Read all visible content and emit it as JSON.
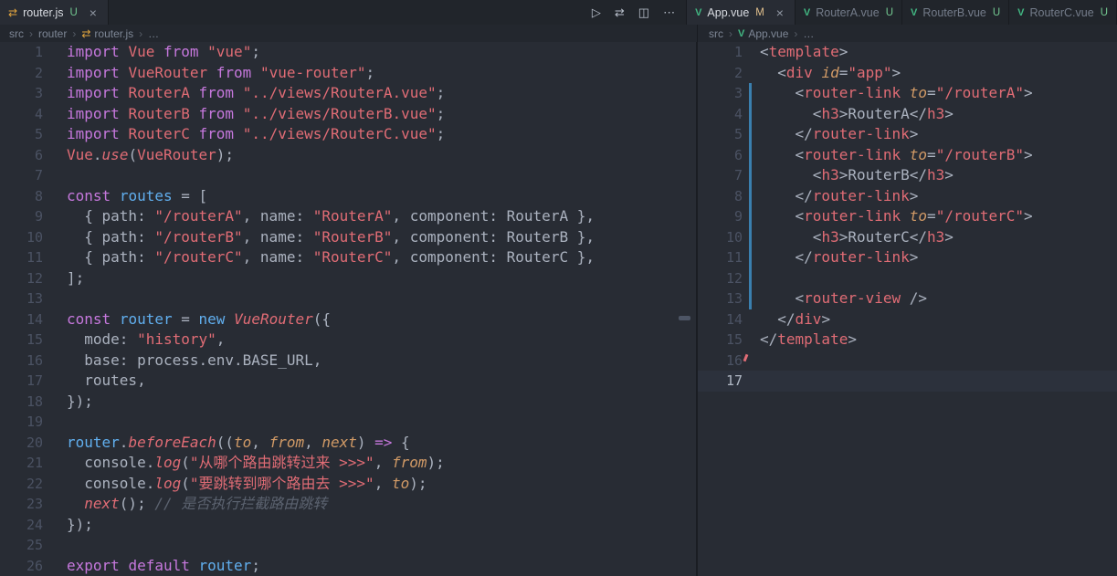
{
  "icons": {
    "vue": "V",
    "routing": "⇄",
    "close": "×",
    "crumb_sep": "›"
  },
  "colors": {
    "keyword": "#c678dd",
    "string": "#e06c75",
    "attribute": "#d19a66",
    "identifier_blue": "#61afef",
    "comment": "#5c6370",
    "git_untracked": "#73c991",
    "git_modified": "#e2c08d",
    "vue_green": "#42b883",
    "gutter_modified_bar": "#3a7fae"
  },
  "tabs_left": [
    {
      "label": "router.js",
      "status": "U",
      "icon": "routing",
      "active": true,
      "closable": true
    }
  ],
  "tabs_right": [
    {
      "label": "App.vue",
      "status": "M",
      "icon": "vue",
      "active": true,
      "closable": true
    },
    {
      "label": "RouterA.vue",
      "status": "U",
      "icon": "vue",
      "active": false
    },
    {
      "label": "RouterB.vue",
      "status": "U",
      "icon": "vue",
      "active": false
    },
    {
      "label": "RouterC.vue",
      "status": "U",
      "icon": "vue",
      "active": false
    }
  ],
  "actions": [
    {
      "name": "run",
      "glyph": "▷"
    },
    {
      "name": "open-changes",
      "glyph": "⇄"
    },
    {
      "name": "split-editor",
      "glyph": "◫"
    },
    {
      "name": "more-actions",
      "glyph": "⋯"
    }
  ],
  "breadcrumbs_left": [
    {
      "label": "src"
    },
    {
      "label": "router"
    },
    {
      "label": "router.js",
      "icon": "routing"
    },
    {
      "label": "…"
    }
  ],
  "breadcrumbs_right": [
    {
      "label": "src"
    },
    {
      "label": "App.vue",
      "icon": "vue"
    },
    {
      "label": "…"
    }
  ],
  "editor_left": {
    "lines": [
      {
        "t": [
          [
            "k",
            "import"
          ],
          [
            "d",
            " "
          ],
          [
            "e",
            "Vue"
          ],
          [
            "d",
            " "
          ],
          [
            "k",
            "from"
          ],
          [
            "d",
            " "
          ],
          [
            "s",
            "\"vue\""
          ],
          [
            "d",
            ";"
          ]
        ]
      },
      {
        "t": [
          [
            "k",
            "import"
          ],
          [
            "d",
            " "
          ],
          [
            "e",
            "VueRouter"
          ],
          [
            "d",
            " "
          ],
          [
            "k",
            "from"
          ],
          [
            "d",
            " "
          ],
          [
            "s",
            "\"vue-router\""
          ],
          [
            "d",
            ";"
          ]
        ]
      },
      {
        "t": [
          [
            "k",
            "import"
          ],
          [
            "d",
            " "
          ],
          [
            "e",
            "RouterA"
          ],
          [
            "d",
            " "
          ],
          [
            "k",
            "from"
          ],
          [
            "d",
            " "
          ],
          [
            "s",
            "\"../views/RouterA.vue\""
          ],
          [
            "d",
            ";"
          ]
        ]
      },
      {
        "t": [
          [
            "k",
            "import"
          ],
          [
            "d",
            " "
          ],
          [
            "e",
            "RouterB"
          ],
          [
            "d",
            " "
          ],
          [
            "k",
            "from"
          ],
          [
            "d",
            " "
          ],
          [
            "s",
            "\"../views/RouterB.vue\""
          ],
          [
            "d",
            ";"
          ]
        ]
      },
      {
        "t": [
          [
            "k",
            "import"
          ],
          [
            "d",
            " "
          ],
          [
            "e",
            "RouterC"
          ],
          [
            "d",
            " "
          ],
          [
            "k",
            "from"
          ],
          [
            "d",
            " "
          ],
          [
            "s",
            "\"../views/RouterC.vue\""
          ],
          [
            "d",
            ";"
          ]
        ]
      },
      {
        "t": [
          [
            "e",
            "Vue"
          ],
          [
            "d",
            "."
          ],
          [
            "f",
            "use"
          ],
          [
            "d",
            "("
          ],
          [
            "e",
            "VueRouter"
          ],
          [
            "d",
            ");"
          ]
        ]
      },
      {
        "t": []
      },
      {
        "t": [
          [
            "k",
            "const"
          ],
          [
            "d",
            " "
          ],
          [
            "b",
            "routes"
          ],
          [
            "d",
            " = ["
          ]
        ]
      },
      {
        "t": [
          [
            "d",
            "  { path: "
          ],
          [
            "s",
            "\"/routerA\""
          ],
          [
            "d",
            ", name: "
          ],
          [
            "s",
            "\"RouterA\""
          ],
          [
            "d",
            ", component: RouterA },"
          ]
        ]
      },
      {
        "t": [
          [
            "d",
            "  { path: "
          ],
          [
            "s",
            "\"/routerB\""
          ],
          [
            "d",
            ", name: "
          ],
          [
            "s",
            "\"RouterB\""
          ],
          [
            "d",
            ", component: RouterB },"
          ]
        ]
      },
      {
        "t": [
          [
            "d",
            "  { path: "
          ],
          [
            "s",
            "\"/routerC\""
          ],
          [
            "d",
            ", name: "
          ],
          [
            "s",
            "\"RouterC\""
          ],
          [
            "d",
            ", component: RouterC },"
          ]
        ]
      },
      {
        "t": [
          [
            "d",
            "];"
          ]
        ]
      },
      {
        "t": []
      },
      {
        "t": [
          [
            "k",
            "const"
          ],
          [
            "d",
            " "
          ],
          [
            "b",
            "router"
          ],
          [
            "d",
            " = "
          ],
          [
            "b",
            "new"
          ],
          [
            "d",
            " "
          ],
          [
            "f",
            "VueRouter"
          ],
          [
            "d",
            "({"
          ]
        ]
      },
      {
        "t": [
          [
            "d",
            "  mode: "
          ],
          [
            "s",
            "\"history\""
          ],
          [
            "d",
            ","
          ]
        ]
      },
      {
        "t": [
          [
            "d",
            "  base: process.env.BASE_URL,"
          ]
        ]
      },
      {
        "t": [
          [
            "d",
            "  routes,"
          ]
        ]
      },
      {
        "t": [
          [
            "d",
            "});"
          ]
        ]
      },
      {
        "t": []
      },
      {
        "t": [
          [
            "b",
            "router"
          ],
          [
            "d",
            "."
          ],
          [
            "f",
            "beforeEach"
          ],
          [
            "d",
            "(("
          ],
          [
            "o",
            "to"
          ],
          [
            "d",
            ", "
          ],
          [
            "o",
            "from"
          ],
          [
            "d",
            ", "
          ],
          [
            "o",
            "next"
          ],
          [
            "d",
            ") "
          ],
          [
            "k",
            "=>"
          ],
          [
            "d",
            " {"
          ]
        ]
      },
      {
        "t": [
          [
            "d",
            "  console."
          ],
          [
            "f",
            "log"
          ],
          [
            "d",
            "("
          ],
          [
            "s",
            "\"从哪个路由跳转过来 >>>\""
          ],
          [
            "d",
            ", "
          ],
          [
            "o",
            "from"
          ],
          [
            "d",
            ");"
          ]
        ]
      },
      {
        "t": [
          [
            "d",
            "  console."
          ],
          [
            "f",
            "log"
          ],
          [
            "d",
            "("
          ],
          [
            "s",
            "\"要跳转到哪个路由去 >>>\""
          ],
          [
            "d",
            ", "
          ],
          [
            "o",
            "to"
          ],
          [
            "d",
            ");"
          ]
        ]
      },
      {
        "t": [
          [
            "d",
            "  "
          ],
          [
            "f",
            "next"
          ],
          [
            "d",
            "(); "
          ],
          [
            "c",
            "// 是否执行拦截路由跳转"
          ]
        ]
      },
      {
        "t": [
          [
            "d",
            "});"
          ]
        ]
      },
      {
        "t": []
      },
      {
        "t": [
          [
            "k",
            "export"
          ],
          [
            "d",
            " "
          ],
          [
            "k",
            "default"
          ],
          [
            "d",
            " "
          ],
          [
            "b",
            "router"
          ],
          [
            "d",
            ";"
          ]
        ]
      }
    ]
  },
  "editor_right": {
    "lines": [
      {
        "t": [
          [
            "d",
            "<"
          ],
          [
            "t",
            "template"
          ],
          [
            "d",
            ">"
          ]
        ]
      },
      {
        "t": [
          [
            "d",
            "  <"
          ],
          [
            "t",
            "div"
          ],
          [
            "d",
            " "
          ],
          [
            "a",
            "id"
          ],
          [
            "d",
            "="
          ],
          [
            "s",
            "\"app\""
          ],
          [
            "d",
            ">"
          ]
        ]
      },
      {
        "t": [
          [
            "d",
            "    <"
          ],
          [
            "t",
            "router-link"
          ],
          [
            "d",
            " "
          ],
          [
            "a",
            "to"
          ],
          [
            "d",
            "="
          ],
          [
            "s",
            "\"/routerA\""
          ],
          [
            "d",
            ">"
          ]
        ],
        "git": true
      },
      {
        "t": [
          [
            "d",
            "      <"
          ],
          [
            "t",
            "h3"
          ],
          [
            "d",
            ">RouterA</"
          ],
          [
            "t",
            "h3"
          ],
          [
            "d",
            ">"
          ]
        ],
        "git": true
      },
      {
        "t": [
          [
            "d",
            "    </"
          ],
          [
            "t",
            "router-link"
          ],
          [
            "d",
            ">"
          ]
        ],
        "git": true
      },
      {
        "t": [
          [
            "d",
            "    <"
          ],
          [
            "t",
            "router-link"
          ],
          [
            "d",
            " "
          ],
          [
            "a",
            "to"
          ],
          [
            "d",
            "="
          ],
          [
            "s",
            "\"/routerB\""
          ],
          [
            "d",
            ">"
          ]
        ],
        "git": true
      },
      {
        "t": [
          [
            "d",
            "      <"
          ],
          [
            "t",
            "h3"
          ],
          [
            "d",
            ">RouterB</"
          ],
          [
            "t",
            "h3"
          ],
          [
            "d",
            ">"
          ]
        ],
        "git": true
      },
      {
        "t": [
          [
            "d",
            "    </"
          ],
          [
            "t",
            "router-link"
          ],
          [
            "d",
            ">"
          ]
        ],
        "git": true
      },
      {
        "t": [
          [
            "d",
            "    <"
          ],
          [
            "t",
            "router-link"
          ],
          [
            "d",
            " "
          ],
          [
            "a",
            "to"
          ],
          [
            "d",
            "="
          ],
          [
            "s",
            "\"/routerC\""
          ],
          [
            "d",
            ">"
          ]
        ],
        "git": true
      },
      {
        "t": [
          [
            "d",
            "      <"
          ],
          [
            "t",
            "h3"
          ],
          [
            "d",
            ">RouterC</"
          ],
          [
            "t",
            "h3"
          ],
          [
            "d",
            ">"
          ]
        ],
        "git": true
      },
      {
        "t": [
          [
            "d",
            "    </"
          ],
          [
            "t",
            "router-link"
          ],
          [
            "d",
            ">"
          ]
        ],
        "git": true
      },
      {
        "t": [],
        "git": true
      },
      {
        "t": [
          [
            "d",
            "    <"
          ],
          [
            "t",
            "router-view"
          ],
          [
            "d",
            " />"
          ]
        ],
        "git": true
      },
      {
        "t": [
          [
            "d",
            "  </"
          ],
          [
            "t",
            "div"
          ],
          [
            "d",
            ">"
          ]
        ]
      },
      {
        "t": [
          [
            "d",
            "</"
          ],
          [
            "t",
            "template"
          ],
          [
            "d",
            ">"
          ]
        ]
      },
      {
        "t": [],
        "mark": true
      },
      {
        "t": [],
        "current": true
      }
    ]
  }
}
